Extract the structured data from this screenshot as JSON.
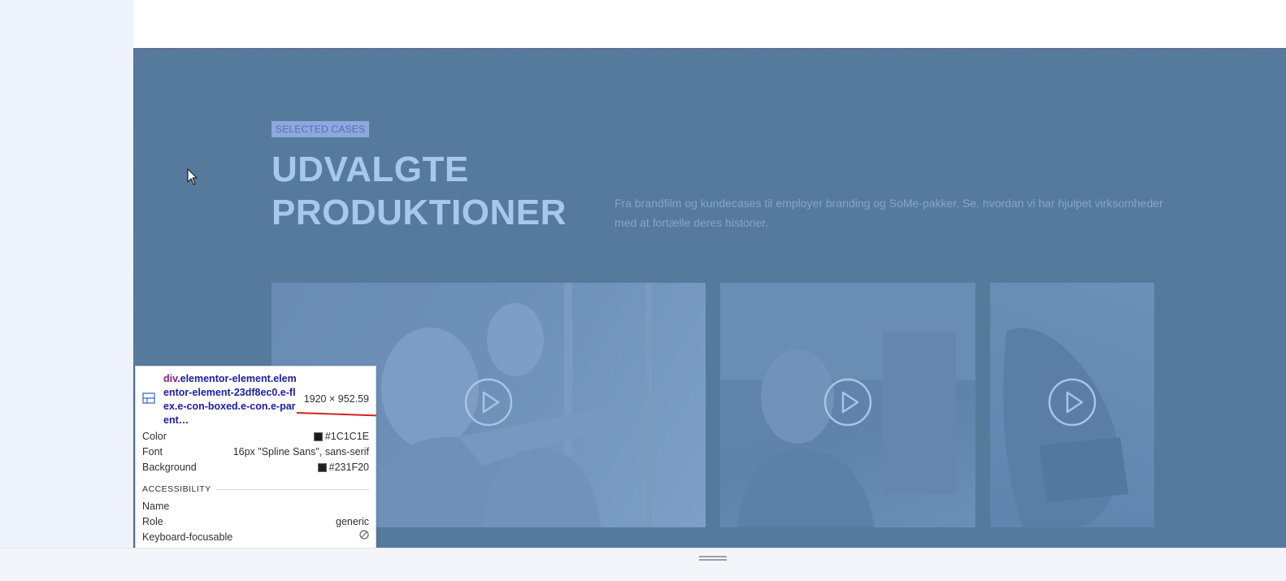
{
  "section": {
    "eyebrow": "SELECTED CASES",
    "headline_line1": "UDVALGTE",
    "headline_line2": "PRODUKTIONER",
    "intro_line1": "Fra brandfilm og kundecases til employer branding og SoMe-pakker. Se, hvordan vi har hjulpet virksomheder",
    "intro_line2": "med at fortælle deres historier."
  },
  "cards": [
    {
      "icon": "play-icon"
    },
    {
      "icon": "play-icon"
    },
    {
      "icon": "play-icon"
    }
  ],
  "inspector": {
    "selector_tag": "div",
    "selector_rest": ".elementor-element.elementor-element-23df8ec0.e-flex.e-con-boxed.e-con.e-parent…",
    "dimensions": "1920 × 952.59",
    "color_label": "Color",
    "color_value": "#1C1C1E",
    "font_label": "Font",
    "font_value": "16px \"Spline Sans\", sans-serif",
    "background_label": "Background",
    "background_value": "#231F20",
    "accessibility_heading": "ACCESSIBILITY",
    "name_label": "Name",
    "name_value": "",
    "role_label": "Role",
    "role_value": "generic",
    "focusable_label": "Keyboard-focusable",
    "colors": {
      "color_swatch": "#1C1C1E",
      "background_swatch": "#231F20"
    }
  },
  "colors": {
    "section_overlay": "#567a9c",
    "headline": "#a7c8ec",
    "eyebrow_bg": "#8ea8dc",
    "highlight_border": "#7d5a86"
  }
}
